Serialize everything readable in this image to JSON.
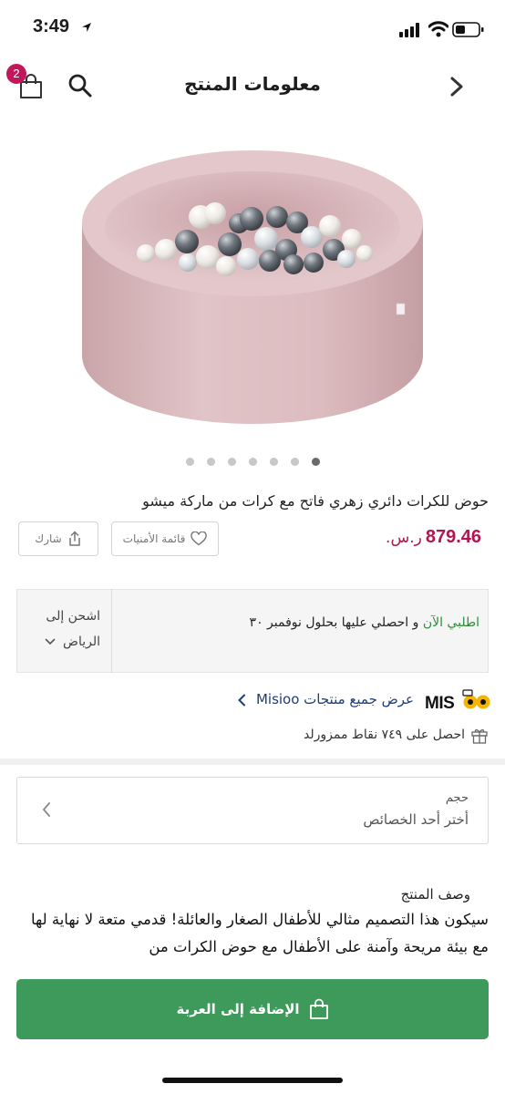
{
  "status_bar": {
    "time": "3:49"
  },
  "header": {
    "title": "معلومات المنتج",
    "cart_count": "2"
  },
  "product": {
    "image_count": 7,
    "active_image": 7,
    "title": "حوض للكرات دائري زهري فاتح مع كرات من ماركة ميشو",
    "price_value": "879.46",
    "currency": "ر.س.",
    "wishlist_label": "قائمة الأمنيات",
    "share_label": "شارك"
  },
  "delivery": {
    "order_now": "اطلبي الآن",
    "get_it": "و احصلي عليها بحلول نوفمبر ٣٠",
    "ship_to": "اشحن إلى",
    "city": "الرياض"
  },
  "brand": {
    "view_all": "عرض جميع منتجات Misioo",
    "logo_text": "MISIOO",
    "points": "احصل على ٧٤٩ نقاط ممزورلد"
  },
  "size": {
    "label": "حجم",
    "placeholder": "أختر أحد الخصائص"
  },
  "description": {
    "heading": "وصف المنتج",
    "text": "سيكون هذا التصميم مثالي للأطفال الصغار والعائلة! قدمي متعة لا نهاية لها مع بيئة مريحة وآمنة على الأطفال مع حوض الكرات من"
  },
  "cta": {
    "add_to_cart": "الإضافة إلى العربة"
  },
  "colors": {
    "accent": "#b0164f",
    "badge": "#c2185b",
    "green": "#3d9a5b",
    "link": "#1d3d7a"
  }
}
